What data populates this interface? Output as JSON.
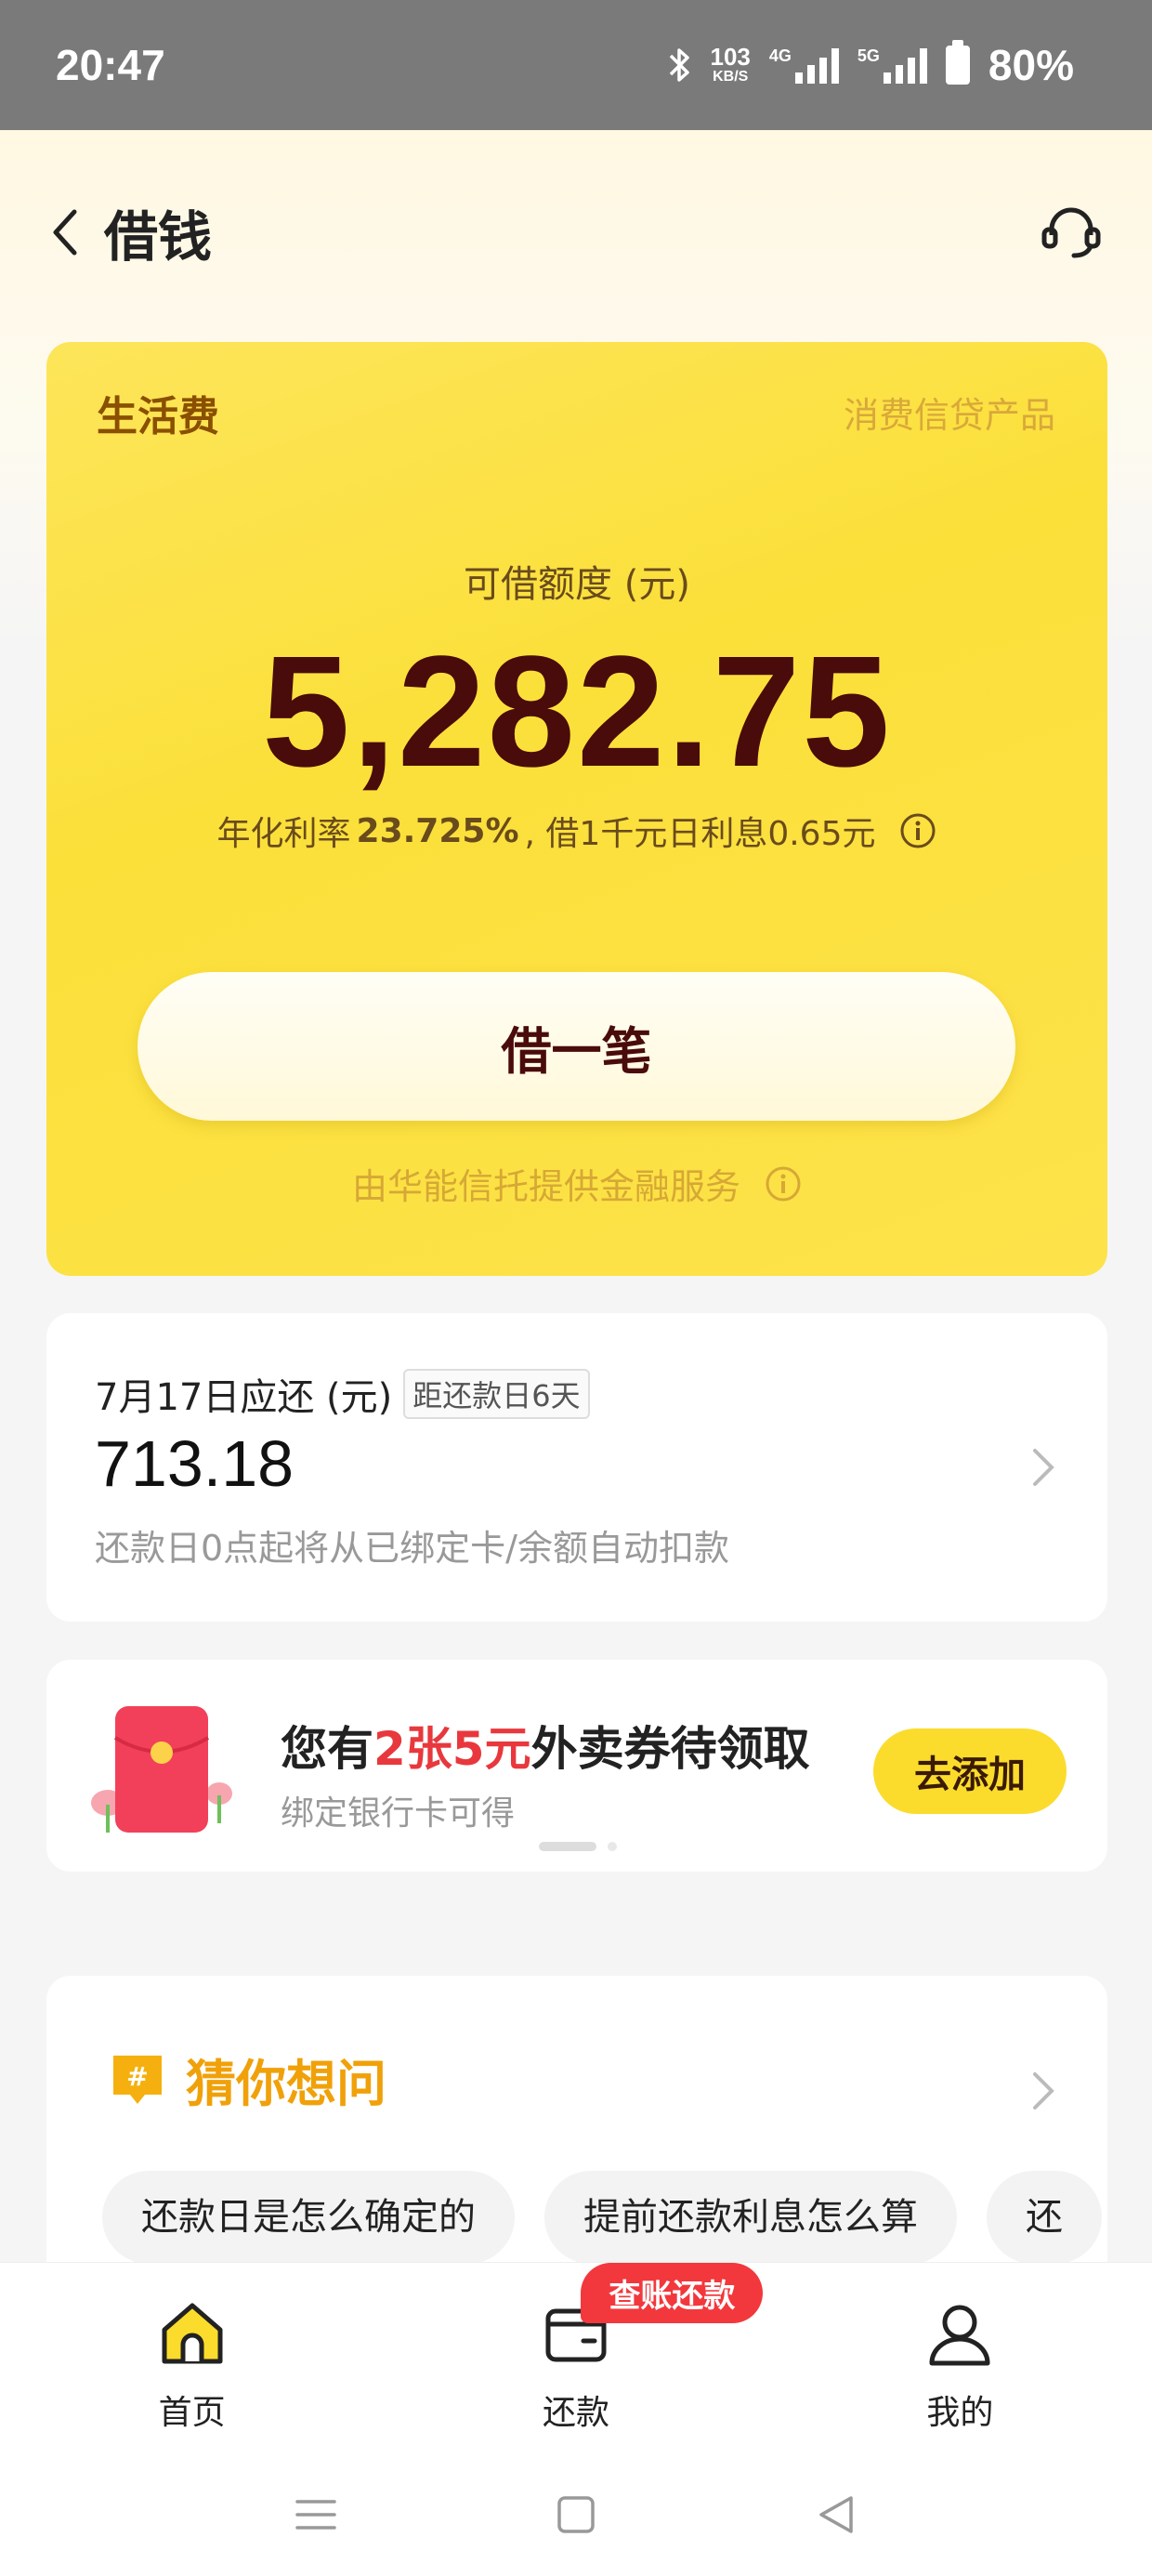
{
  "status_bar": {
    "time": "20:47",
    "net_speed_value": "103",
    "net_speed_unit": "KB/S",
    "sig1_label": "4G",
    "sig2_label": "5G",
    "battery": "80%"
  },
  "header": {
    "title": "借钱"
  },
  "loan_card": {
    "product_name": "生活费",
    "product_tag": "消费信贷产品",
    "limit_label": "可借额度 (元)",
    "limit_amount": "5,282.75",
    "rate_prefix": "年化利率",
    "rate_value": "23.725%",
    "rate_suffix": ", 借1千元日利息0.65元",
    "borrow_button": "借一笔",
    "provider_note": "由华能信托提供金融服务"
  },
  "repay_card": {
    "title": "7月17日应还 (元)",
    "days_badge": "距还款日6天",
    "amount": "713.18",
    "note": "还款日0点起将从已绑定卡/余额自动扣款"
  },
  "promo_card": {
    "title_a": "您有",
    "title_highlight": "2张5元",
    "title_b": "外卖券待领取",
    "subtitle": "绑定银行卡可得",
    "button": "去添加"
  },
  "faq": {
    "title": "猜你想问",
    "chips": [
      "还款日是怎么确定的",
      "提前还款利息怎么算",
      "还"
    ]
  },
  "tabbar": {
    "items": [
      {
        "label": "首页",
        "icon": "home-icon"
      },
      {
        "label": "还款",
        "icon": "wallet-icon",
        "badge": "查账还款"
      },
      {
        "label": "我的",
        "icon": "user-icon"
      }
    ]
  },
  "colors": {
    "accent_yellow": "#fbdc2c",
    "amount_dark": "#4a0b0b",
    "highlight_red": "#e8383d",
    "faq_orange": "#f0a10a"
  }
}
